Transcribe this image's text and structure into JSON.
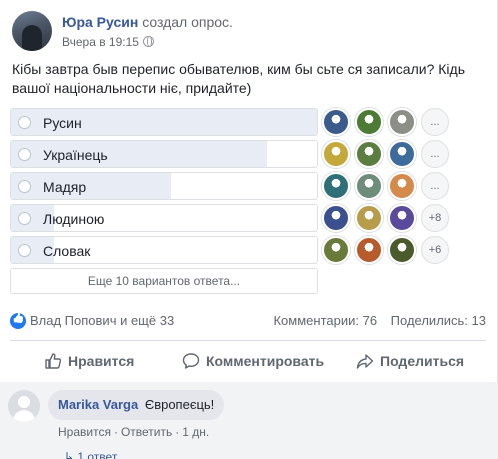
{
  "post": {
    "author": "Юра Русин",
    "action": "создал опрос.",
    "time": "Вчера в 19:15",
    "icon": "globe-icon",
    "text": "Кібы завтра быв перепис обывателюв, ким бы сьте ся записали? Кідь вашої національности ніє, придайте)"
  },
  "poll": {
    "options": [
      {
        "label": "Русин",
        "fill": 1.0,
        "voter_colors": [
          "#3b5b8c",
          "#4d7a34",
          "#8c8f86"
        ],
        "more": "..."
      },
      {
        "label": "Українець",
        "fill": 0.83,
        "voter_colors": [
          "#c4a83a",
          "#5b7d3f",
          "#3d6b9c"
        ],
        "more": "..."
      },
      {
        "label": "Мадяр",
        "fill": 0.52,
        "voter_colors": [
          "#2f6f78",
          "#6e8c7a",
          "#d38a4b"
        ],
        "more": "..."
      },
      {
        "label": "Людиною",
        "fill": 0.14,
        "voter_colors": [
          "#3c4f8e",
          "#b79c4a",
          "#5a4a9c"
        ],
        "more": "+8"
      },
      {
        "label": "Словак",
        "fill": 0.14,
        "voter_colors": [
          "#6a7a3a",
          "#b85b2c",
          "#4b5a2b"
        ],
        "more": "+6"
      }
    ],
    "more_variants": "Еще 10 вариантов ответа..."
  },
  "stats": {
    "likes_icon": "like-icon",
    "likers": "Влад Попович и ещё 33",
    "comments": "Комментарии: 76",
    "shares": "Поделились: 13"
  },
  "actions": {
    "like": "Нравится",
    "comment": "Комментировать",
    "share": "Поделиться"
  },
  "comment": {
    "author": "Marika Varga",
    "text": "Європеєць!",
    "like": "Нравится",
    "reply": "Ответить",
    "time": "1 дн.",
    "replies": "1 ответ"
  },
  "colors": {
    "link": "#385898",
    "bar_fill": "#e7ecf5",
    "like_blue": "#2078f4"
  }
}
